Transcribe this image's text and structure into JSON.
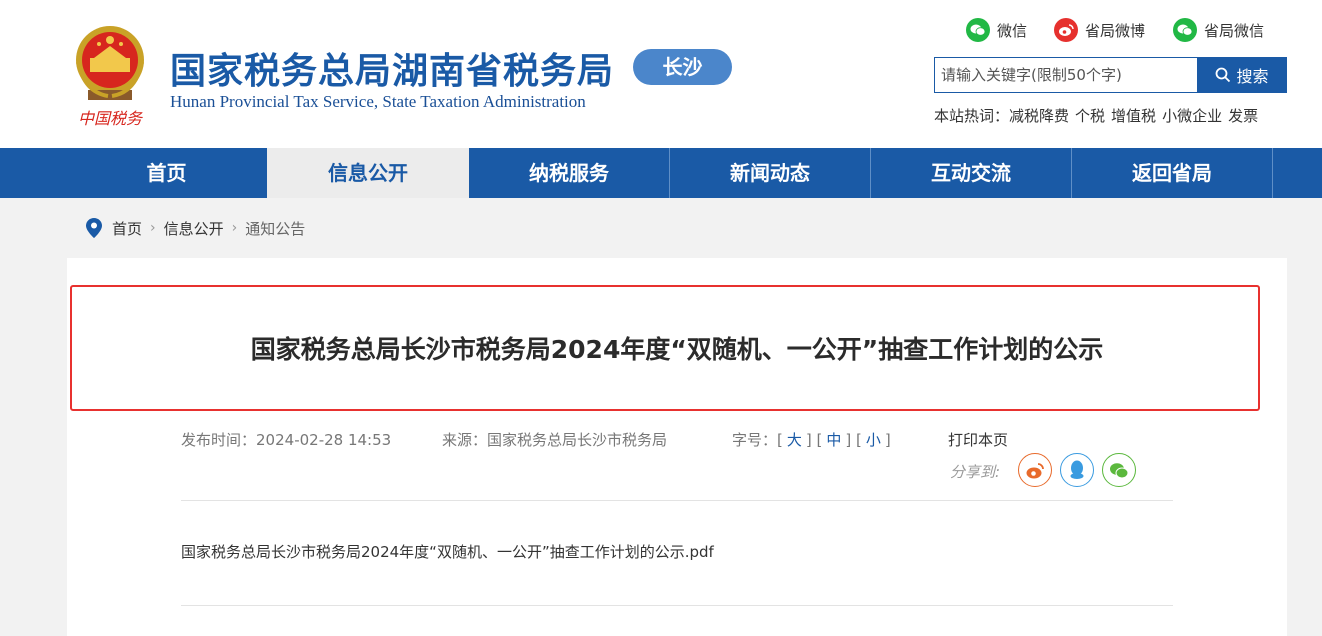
{
  "header": {
    "site_title": "国家税务总局湖南省税务局",
    "site_subtitle": "Hunan Provincial  Tax Service,  State Taxation Administration",
    "city_badge": "长沙",
    "emblem_caption": "中国税务",
    "social": [
      {
        "label": "微信",
        "icon": "wechat-icon",
        "color": "#21b845"
      },
      {
        "label": "省局微博",
        "icon": "weibo-icon",
        "color": "#e6312e"
      },
      {
        "label": "省局微信",
        "icon": "wechat-icon",
        "color": "#21b845"
      }
    ],
    "search": {
      "placeholder": "请输入关键字(限制50个字)",
      "button_label": "搜索"
    },
    "hot_label": "本站热词：",
    "hot_words": [
      "减税降费",
      "个税",
      "增值税",
      "小微企业",
      "发票"
    ]
  },
  "nav": {
    "items": [
      "首页",
      "信息公开",
      "纳税服务",
      "新闻动态",
      "互动交流",
      "返回省局"
    ],
    "active": "信息公开"
  },
  "breadcrumb": [
    "首页",
    "信息公开",
    "通知公告"
  ],
  "article": {
    "title": "国家税务总局长沙市税务局2024年度“双随机、一公开”抽查工作计划的公示",
    "publish_label": "发布时间：",
    "publish_time": "2024-02-28 14:53",
    "source_label": "来源：",
    "source": "国家税务总局长沙市税务局",
    "font_size_label": "字号：",
    "font_sizes": [
      "大",
      "中",
      "小"
    ],
    "print_label": "打印本页",
    "share_label": "分享到:",
    "share_targets": [
      {
        "icon": "weibo-icon",
        "color": "#e86a2b"
      },
      {
        "icon": "qq-icon",
        "color": "#3a9be0"
      },
      {
        "icon": "wechat-icon",
        "color": "#5bb83d"
      }
    ],
    "attachment": "国家税务总局长沙市税务局2024年度“双随机、一公开”抽查工作计划的公示.pdf"
  },
  "colors": {
    "brand": "#1a5aa6",
    "badge": "#4b86cb",
    "highlight": "#e8312f"
  }
}
